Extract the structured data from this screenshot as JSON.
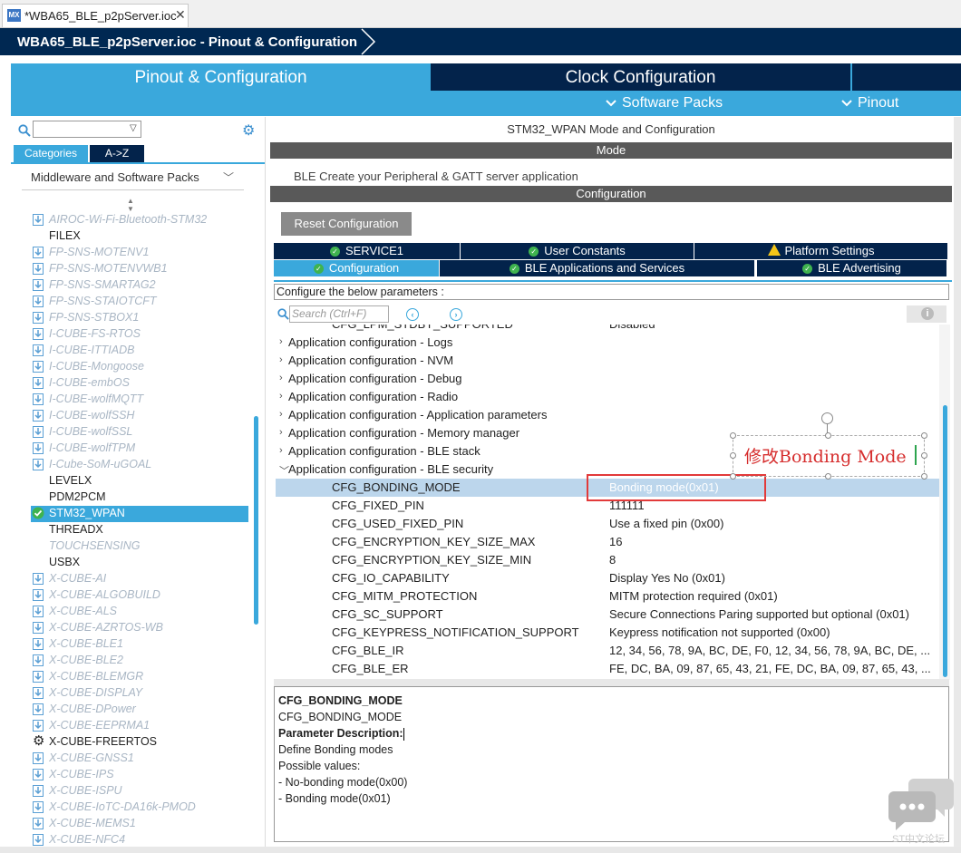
{
  "editor_tab": {
    "badge": "MX",
    "label": "*WBA65_BLE_p2pServer.ioc",
    "close": "✕"
  },
  "breadcrumb": {
    "text": "WBA65_BLE_p2pServer.ioc - Pinout & Configuration"
  },
  "main_tabs": {
    "pinout": "Pinout & Configuration",
    "clock": "Clock Configuration",
    "software_packs": "Software Packs",
    "pinout_menu": "Pinout",
    "chevron": "❯"
  },
  "left": {
    "tab_categories": "Categories",
    "tab_az": "A->Z",
    "group": "Middleware and Software Packs",
    "items": [
      {
        "label": "AIROC-Wi-Fi-Bluetooth-STM32",
        "state": "dis",
        "icon": "download"
      },
      {
        "label": "FILEX",
        "state": "nor",
        "icon": "none"
      },
      {
        "label": "FP-SNS-MOTENV1",
        "state": "dis",
        "icon": "download"
      },
      {
        "label": "FP-SNS-MOTENVWB1",
        "state": "dis",
        "icon": "download"
      },
      {
        "label": "FP-SNS-SMARTAG2",
        "state": "dis",
        "icon": "download"
      },
      {
        "label": "FP-SNS-STAIOTCFT",
        "state": "dis",
        "icon": "download"
      },
      {
        "label": "FP-SNS-STBOX1",
        "state": "dis",
        "icon": "download"
      },
      {
        "label": "I-CUBE-FS-RTOS",
        "state": "dis",
        "icon": "download"
      },
      {
        "label": "I-CUBE-ITTIADB",
        "state": "dis",
        "icon": "download"
      },
      {
        "label": "I-CUBE-Mongoose",
        "state": "dis",
        "icon": "download"
      },
      {
        "label": "I-CUBE-embOS",
        "state": "dis",
        "icon": "download"
      },
      {
        "label": "I-CUBE-wolfMQTT",
        "state": "dis",
        "icon": "download"
      },
      {
        "label": "I-CUBE-wolfSSH",
        "state": "dis",
        "icon": "download"
      },
      {
        "label": "I-CUBE-wolfSSL",
        "state": "dis",
        "icon": "download"
      },
      {
        "label": "I-CUBE-wolfTPM",
        "state": "dis",
        "icon": "download"
      },
      {
        "label": "I-Cube-SoM-uGOAL",
        "state": "dis",
        "icon": "download"
      },
      {
        "label": "LEVELX",
        "state": "nor",
        "icon": "none"
      },
      {
        "label": "PDM2PCM",
        "state": "nor",
        "icon": "none"
      },
      {
        "label": "STM32_WPAN",
        "state": "sel",
        "icon": "check"
      },
      {
        "label": "THREADX",
        "state": "nor",
        "icon": "none"
      },
      {
        "label": "TOUCHSENSING",
        "state": "dis",
        "icon": "none"
      },
      {
        "label": "USBX",
        "state": "nor",
        "icon": "none"
      },
      {
        "label": "X-CUBE-AI",
        "state": "dis",
        "icon": "download"
      },
      {
        "label": "X-CUBE-ALGOBUILD",
        "state": "dis",
        "icon": "download"
      },
      {
        "label": "X-CUBE-ALS",
        "state": "dis",
        "icon": "download"
      },
      {
        "label": "X-CUBE-AZRTOS-WB",
        "state": "dis",
        "icon": "download"
      },
      {
        "label": "X-CUBE-BLE1",
        "state": "dis",
        "icon": "download"
      },
      {
        "label": "X-CUBE-BLE2",
        "state": "dis",
        "icon": "download"
      },
      {
        "label": "X-CUBE-BLEMGR",
        "state": "dis",
        "icon": "download"
      },
      {
        "label": "X-CUBE-DISPLAY",
        "state": "dis",
        "icon": "download"
      },
      {
        "label": "X-CUBE-DPower",
        "state": "dis",
        "icon": "download"
      },
      {
        "label": "X-CUBE-EEPRMA1",
        "state": "dis",
        "icon": "download"
      },
      {
        "label": "X-CUBE-FREERTOS",
        "state": "nor",
        "icon": "gear"
      },
      {
        "label": "X-CUBE-GNSS1",
        "state": "dis",
        "icon": "download"
      },
      {
        "label": "X-CUBE-IPS",
        "state": "dis",
        "icon": "download"
      },
      {
        "label": "X-CUBE-ISPU",
        "state": "dis",
        "icon": "download"
      },
      {
        "label": "X-CUBE-IoTC-DA16k-PMOD",
        "state": "dis",
        "icon": "download"
      },
      {
        "label": "X-CUBE-MEMS1",
        "state": "dis",
        "icon": "download"
      },
      {
        "label": "X-CUBE-NFC4",
        "state": "dis",
        "icon": "download"
      }
    ]
  },
  "right": {
    "title": "STM32_WPAN Mode and Configuration",
    "mode_header": "Mode",
    "ble_line": "BLE  Create your Peripheral & GATT server application",
    "config_header": "Configuration",
    "reset_button": "Reset Configuration",
    "tabs_row1": [
      {
        "label": "SERVICE1",
        "icon": "ok"
      },
      {
        "label": "User Constants",
        "icon": "ok"
      },
      {
        "label": "Platform Settings",
        "icon": "warn"
      }
    ],
    "tabs_row2": [
      {
        "label": "Configuration",
        "icon": "ok"
      },
      {
        "label": "BLE Applications and Services",
        "icon": "ok"
      },
      {
        "label": "BLE Advertising",
        "icon": "ok"
      }
    ],
    "configure_label": "Configure the below parameters :",
    "search_placeholder": "Search (Ctrl+F)",
    "info_icon": "i",
    "clipped_row": {
      "label": "CFG_LPM_STDBY_SUPPORTED",
      "value": "Disabled"
    },
    "groups": [
      "Application configuration - Logs",
      "Application configuration - NVM",
      "Application configuration - Debug",
      "Application configuration - Radio",
      "Application configuration - Application parameters",
      "Application configuration - Memory manager",
      "Application configuration - BLE stack",
      "Application configuration - BLE security"
    ],
    "params": [
      {
        "name": "CFG_BONDING_MODE",
        "value": "Bonding mode(0x01)"
      },
      {
        "name": "CFG_FIXED_PIN",
        "value": "111111"
      },
      {
        "name": "CFG_USED_FIXED_PIN",
        "value": "Use a fixed pin (0x00)"
      },
      {
        "name": "CFG_ENCRYPTION_KEY_SIZE_MAX",
        "value": "16"
      },
      {
        "name": "CFG_ENCRYPTION_KEY_SIZE_MIN",
        "value": "8"
      },
      {
        "name": "CFG_IO_CAPABILITY",
        "value": "Display Yes No (0x01)"
      },
      {
        "name": "CFG_MITM_PROTECTION",
        "value": "MITM protection required (0x01)"
      },
      {
        "name": "CFG_SC_SUPPORT",
        "value": "Secure Connections Paring supported but optional (0x01)"
      },
      {
        "name": "CFG_KEYPRESS_NOTIFICATION_SUPPORT",
        "value": "Keypress notification not supported (0x00)"
      },
      {
        "name": "CFG_BLE_IR",
        "value": "12, 34, 56, 78, 9A, BC, DE, F0, 12, 34, 56, 78, 9A, BC, DE, ..."
      },
      {
        "name": "CFG_BLE_ER",
        "value": "FE, DC, BA, 09, 87, 65, 43, 21, FE, DC, BA, 09, 87, 65, 43, ..."
      }
    ],
    "description": {
      "title": "CFG_BONDING_MODE",
      "name": "CFG_BONDING_MODE",
      "heading": "Parameter Description:",
      "line1": "Define Bonding modes",
      "line2": "Possible values:",
      "line3": "- No-bonding mode(0x00)",
      "line4": "- Bonding mode(0x01)"
    }
  },
  "annotation": {
    "text": "修改Bonding Mode"
  },
  "watermark": {
    "text": "ST中文论坛"
  }
}
